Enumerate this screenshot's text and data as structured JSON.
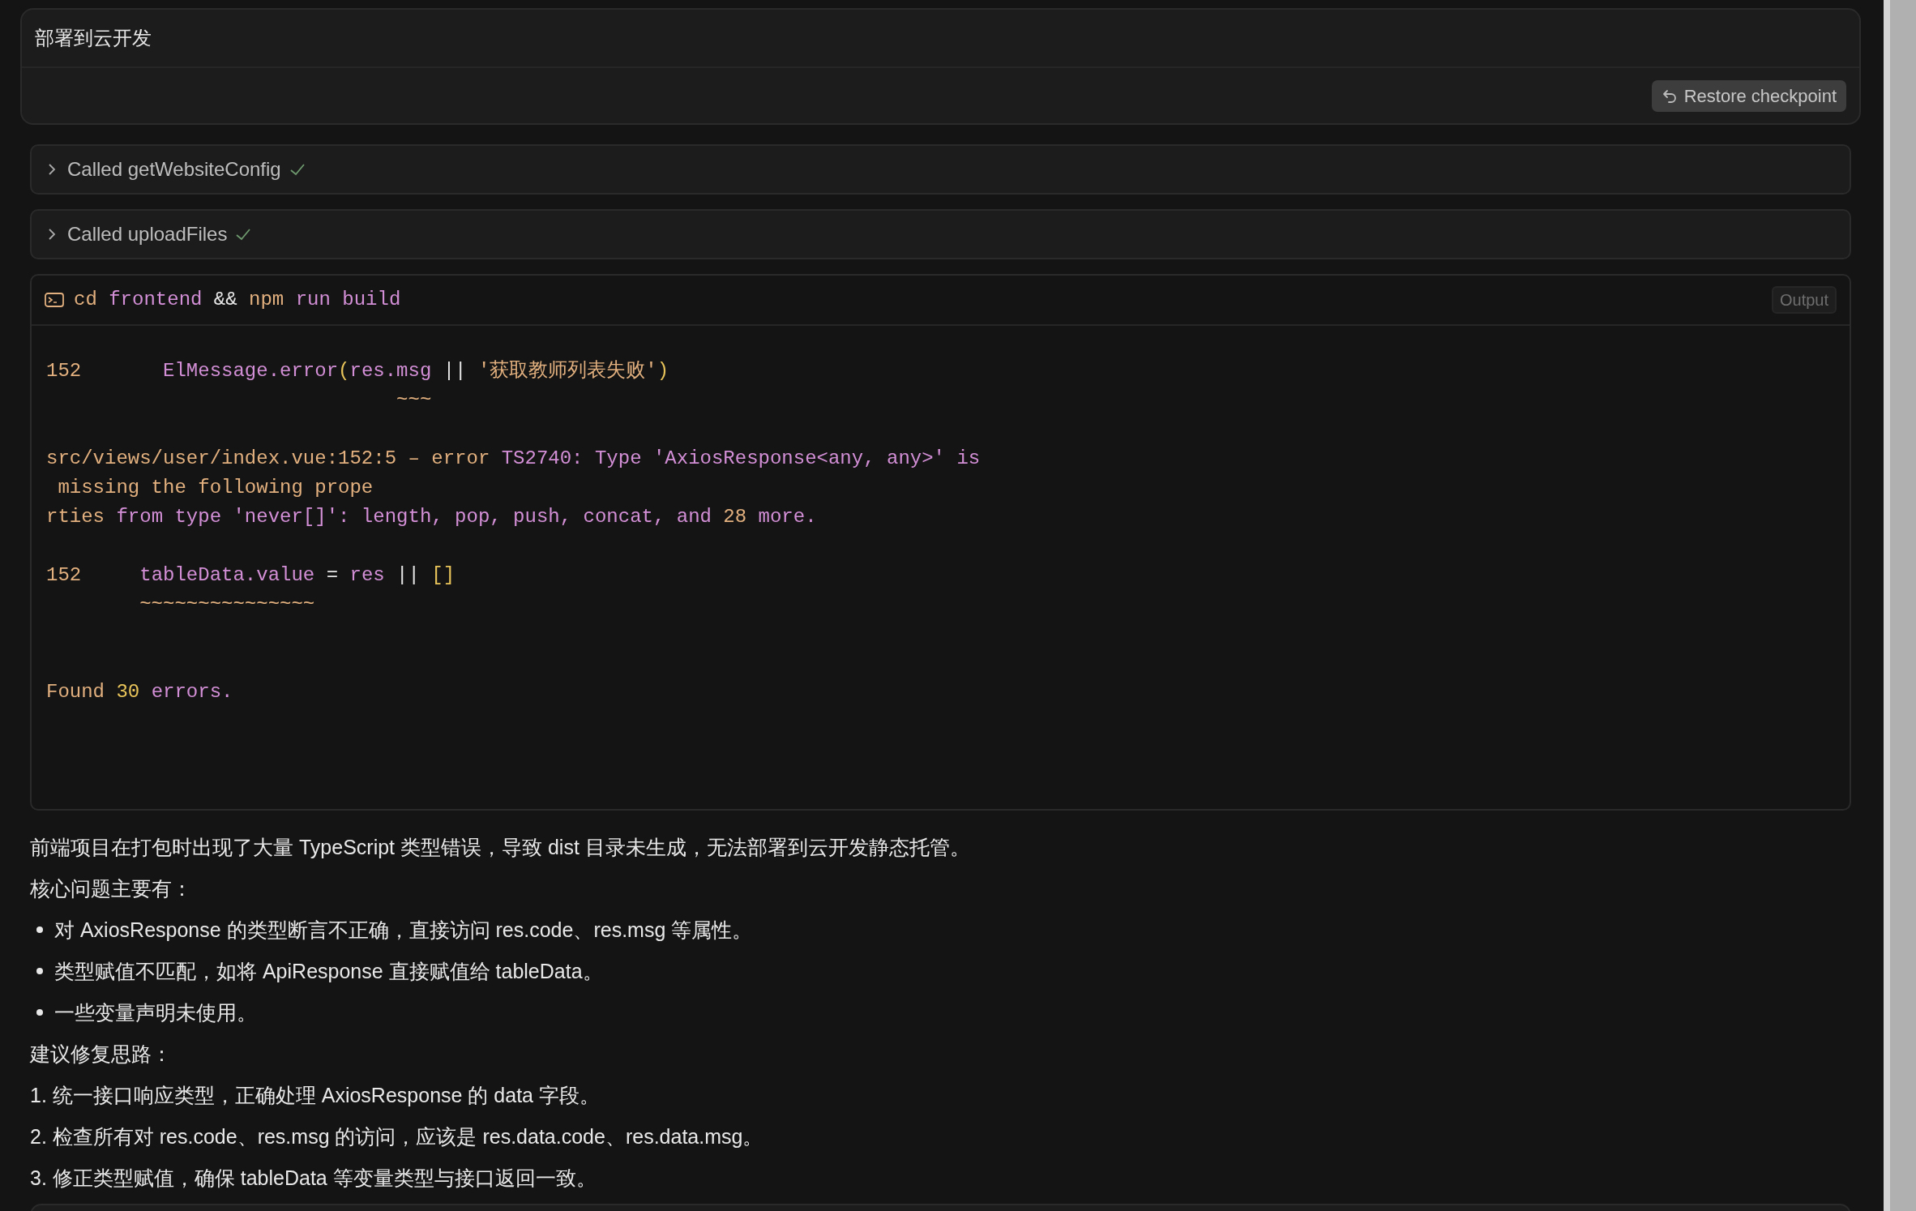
{
  "prompt_card": {
    "title": "部署到云开发",
    "restore_button": "Restore checkpoint"
  },
  "tool_calls": [
    {
      "label": "Called getWebsiteConfig",
      "expanded": false,
      "done": true
    },
    {
      "label": "Called uploadFiles",
      "expanded": false,
      "done": true
    }
  ],
  "terminal": {
    "command": [
      {
        "text": "cd",
        "color": "#e2b07e"
      },
      {
        "text": " frontend ",
        "color": "#d38fd6"
      },
      {
        "text": "&&",
        "color": "#e6e6e6"
      },
      {
        "text": " npm",
        "color": "#e2b07e"
      },
      {
        "text": " run build",
        "color": "#d38fd6"
      }
    ],
    "output_button": "Output",
    "lines": [
      {
        "kind": "code",
        "segments": [
          {
            "text": "152",
            "color": "#e2b07e"
          },
          {
            "text": "       ElMessage.error",
            "color": "#d38fd6"
          },
          {
            "text": "(",
            "color": "#e8c45a"
          },
          {
            "text": "res.msg ",
            "color": "#d38fd6"
          },
          {
            "text": "||",
            "color": "#e6e6e6"
          },
          {
            "text": " '获取教师列表失败'",
            "color": "#e2b07e"
          },
          {
            "text": ")",
            "color": "#e8c45a"
          }
        ]
      },
      {
        "kind": "code",
        "segments": [
          {
            "text": "                              ~~~",
            "color": "#e2b07e"
          }
        ]
      },
      {
        "kind": "blank"
      },
      {
        "kind": "code",
        "segments": [
          {
            "text": "src/views/user/index.vue:152:5 – error ",
            "color": "#e2b07e"
          },
          {
            "text": "TS2740: Type 'AxiosResponse<any, any>' is",
            "color": "#d38fd6"
          }
        ]
      },
      {
        "kind": "code",
        "segments": [
          {
            "text": " missing the following prope",
            "color": "#e2b07e"
          }
        ]
      },
      {
        "kind": "code",
        "segments": [
          {
            "text": "rties ",
            "color": "#e2b07e"
          },
          {
            "text": "from type 'never[]': length, pop, push, concat, and ",
            "color": "#d38fd6"
          },
          {
            "text": "28",
            "color": "#e2b07e"
          },
          {
            "text": " more.",
            "color": "#d38fd6"
          }
        ]
      },
      {
        "kind": "blank"
      },
      {
        "kind": "code",
        "segments": [
          {
            "text": "152",
            "color": "#e2b07e"
          },
          {
            "text": "     tableData.value ",
            "color": "#d38fd6"
          },
          {
            "text": "= ",
            "color": "#e6e6e6"
          },
          {
            "text": "res ",
            "color": "#d38fd6"
          },
          {
            "text": "|| ",
            "color": "#e6e6e6"
          },
          {
            "text": "[]",
            "color": "#e8c45a"
          }
        ]
      },
      {
        "kind": "code",
        "segments": [
          {
            "text": "        ~~~~~~~~~~~~~~~",
            "color": "#e2b07e"
          }
        ]
      },
      {
        "kind": "blank"
      },
      {
        "kind": "blank"
      },
      {
        "kind": "code",
        "segments": [
          {
            "text": "Found ",
            "color": "#e2b07e"
          },
          {
            "text": "30",
            "color": "#e8c45a"
          },
          {
            "text": " errors.",
            "color": "#d38fd6"
          }
        ]
      }
    ]
  },
  "message": [
    {
      "kind": "paragraph",
      "text": "前端项目在打包时出现了大量 TypeScript 类型错误，导致 dist 目录未生成，无法部署到云开发静态托管。"
    },
    {
      "kind": "paragraph",
      "text": "核心问题主要有："
    },
    {
      "kind": "bullet",
      "text": "对 AxiosResponse 的类型断言不正确，直接访问 res.code、res.msg 等属性。"
    },
    {
      "kind": "bullet",
      "text": "类型赋值不匹配，如将 ApiResponse 直接赋值给 tableData。"
    },
    {
      "kind": "bullet",
      "text": "一些变量声明未使用。"
    },
    {
      "kind": "paragraph",
      "text": "建议修复思路："
    },
    {
      "kind": "paragraph",
      "text": "1. 统一接口响应类型，正确处理 AxiosResponse 的 data 字段。"
    },
    {
      "kind": "paragraph",
      "text": "2. 检查所有对 res.code、res.msg 的访问，应该是 res.data.code、res.data.msg。"
    },
    {
      "kind": "paragraph",
      "text": "3. 修正类型赋值，确保 tableData 等变量类型与接口返回一致。"
    }
  ]
}
